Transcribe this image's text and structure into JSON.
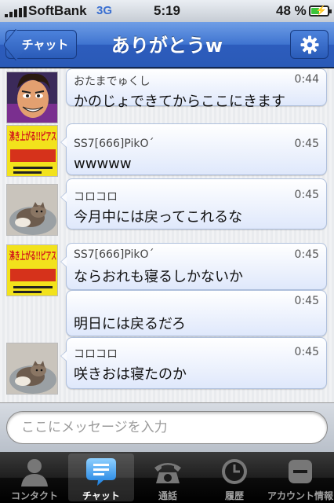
{
  "status_bar": {
    "carrier": "SoftBank",
    "network": "3G",
    "time": "5:19",
    "battery_percent": "48 %",
    "battery_level": 0.48
  },
  "nav": {
    "back_label": "チャット",
    "title": "ありがとうw"
  },
  "messages": [
    {
      "name": "おたまでゅくし",
      "time": "0:44",
      "text": "かのじょできてからここにきます",
      "avatar": "cartoon-face"
    },
    {
      "name": "SS7[666]PikO´",
      "time": "0:45",
      "text": "wwwww",
      "avatar": "yellow-poster"
    },
    {
      "name": "コロコロ",
      "time": "0:45",
      "text": "今月中には戻ってこれるな",
      "avatar": "cat-photo"
    },
    {
      "name": "SS7[666]PikO´",
      "time": "0:45",
      "text": "ならおれも寝るしかないか",
      "avatar": "yellow-poster"
    },
    {
      "name": "",
      "time": "0:45",
      "text": "明日には戻るだろ",
      "avatar": ""
    },
    {
      "name": "コロコロ",
      "time": "0:45",
      "text": "咲きおは寝たのか",
      "avatar": "cat-photo"
    }
  ],
  "avatar_poster_text": "沸き上がる!!ピアス",
  "input": {
    "placeholder": "ここにメッセージを入力"
  },
  "tabs": [
    {
      "label": "コンタクト",
      "icon": "person-icon",
      "active": false
    },
    {
      "label": "チャット",
      "icon": "chat-bubble-icon",
      "active": true
    },
    {
      "label": "通話",
      "icon": "phone-icon",
      "active": false
    },
    {
      "label": "履歴",
      "icon": "clock-icon",
      "active": false
    },
    {
      "label": "アカウント情報",
      "icon": "account-icon",
      "active": false
    }
  ]
}
